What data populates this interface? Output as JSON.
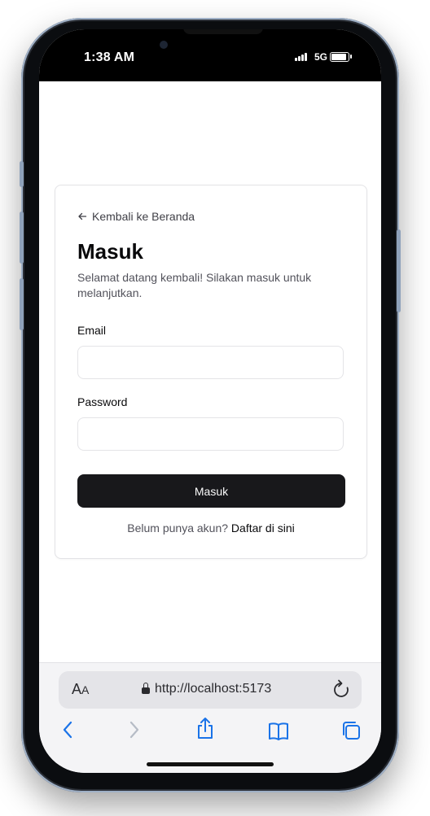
{
  "status_bar": {
    "time": "1:38 AM",
    "network": "5G"
  },
  "page": {
    "back_link": "Kembali ke Beranda",
    "title": "Masuk",
    "subtitle": "Selamat datang kembali! Silakan masuk untuk melanjutkan.",
    "email_label": "Email",
    "email_value": "",
    "password_label": "Password",
    "password_value": "",
    "submit_label": "Masuk",
    "signup_prompt": "Belum punya akun?",
    "signup_link": "Daftar di sini"
  },
  "browser": {
    "text_size_big": "A",
    "text_size_small": "A",
    "url": "http://localhost:5173"
  },
  "colors": {
    "button_bg": "#18181b",
    "accent_blue": "#1a73e8"
  },
  "icons": {
    "back": "arrow-left-icon",
    "lock": "lock-icon",
    "reload": "reload-icon",
    "nav_back": "chevron-left-icon",
    "nav_forward": "chevron-right-icon",
    "share": "share-icon",
    "bookmarks": "book-icon",
    "tabs": "tabs-icon"
  }
}
